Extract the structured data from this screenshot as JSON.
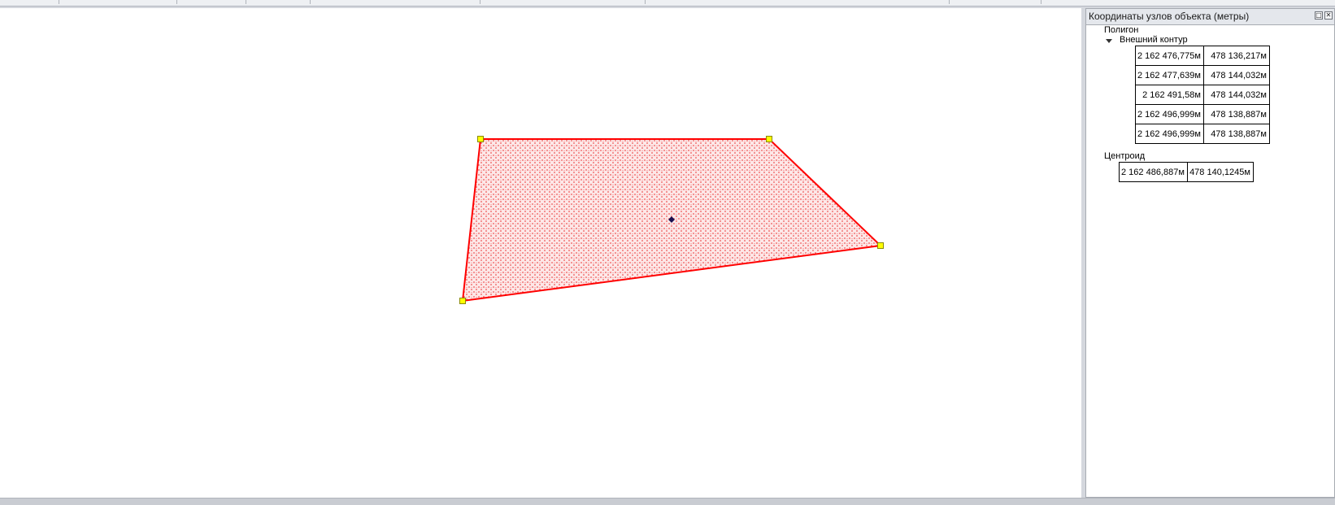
{
  "panel": {
    "title": "Координаты узлов объекта (метры)",
    "float_button_icon": "float-window-icon",
    "close_button_icon": "close-icon",
    "geometry_type": "Полигон",
    "outer_contour_label": "Внешний контур",
    "centroid_label": "Центроид",
    "outer_contour": [
      {
        "x": "2 162 476,775м",
        "y": "478 136,217м"
      },
      {
        "x": "2 162 477,639м",
        "y": "478 144,032м"
      },
      {
        "x": "2 162 491,58м",
        "y": "478 144,032м"
      },
      {
        "x": "2 162 496,999м",
        "y": "478 138,887м"
      },
      {
        "x": "2 162 496,999м",
        "y": "478 138,887м"
      }
    ],
    "centroid": {
      "x": "2 162 486,887м",
      "y": "478 140,1245м"
    }
  },
  "map": {
    "fill_color": "#f0a0a0",
    "stroke_color": "#ff0000",
    "vertex_color": "#ffff00",
    "centroid_color": "#1a1050",
    "vertex_icon": "vertex-handle-icon",
    "centroid_icon": "centroid-marker-icon"
  }
}
